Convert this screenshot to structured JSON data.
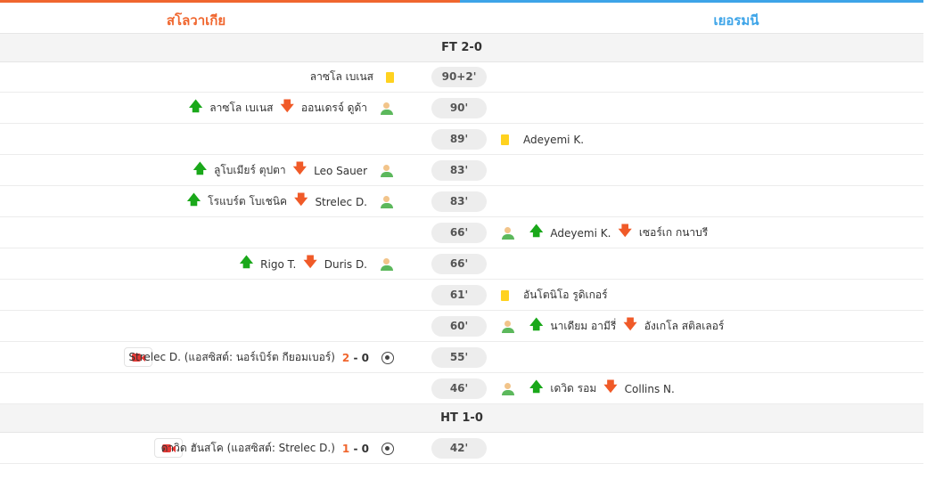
{
  "teams": {
    "home": "สโลวาเกีย",
    "away": "เยอรมนี"
  },
  "periods": {
    "ft": "FT 2-0",
    "ht": "HT 1-0"
  },
  "events": [
    {
      "minute": "90+2'",
      "side": "home",
      "type": "yellow",
      "player": "ลาซโล เบเนส"
    },
    {
      "minute": "90'",
      "side": "home",
      "type": "sub",
      "in": "ลาซโล เบเนส",
      "out": "ออนเดรจ์ ดูด้า"
    },
    {
      "minute": "89'",
      "side": "away",
      "type": "yellow",
      "player": "Adeyemi K."
    },
    {
      "minute": "83'",
      "side": "home",
      "type": "sub",
      "in": "ลูโบเมียร์ ตุปตา",
      "out": "Leo Sauer"
    },
    {
      "minute": "83'",
      "side": "home",
      "type": "sub",
      "in": "โรแบร์ต โบเชนิค",
      "out": "Strelec D."
    },
    {
      "minute": "66'",
      "side": "away",
      "type": "sub",
      "in": "Adeyemi K.",
      "out": "เซอร์เก กนาบรี"
    },
    {
      "minute": "66'",
      "side": "home",
      "type": "sub",
      "in": "Rigo T.",
      "out": "Duris D."
    },
    {
      "minute": "61'",
      "side": "away",
      "type": "yellow",
      "player": "อันโตนิโอ รูดิเกอร์"
    },
    {
      "minute": "60'",
      "side": "away",
      "type": "sub",
      "in": "นาเดียม อามีรี่",
      "out": "อังเกโล สติลเลอร์"
    },
    {
      "minute": "55'",
      "side": "home",
      "type": "goal",
      "text": "Strelec D. (แอสซิสต์: นอร์เบิร์ต กียอมเบอร์)",
      "score_home": "2",
      "sep": "-",
      "score_away": "0"
    },
    {
      "minute": "46'",
      "side": "away",
      "type": "sub",
      "in": "เดวิด รอม",
      "out": "Collins N."
    },
    {
      "minute": "42'",
      "side": "home",
      "type": "goal",
      "text": "ดาวิด ฮันสโค (แอสซิสต์: Strelec D.)",
      "score_home": "1",
      "sep": "-",
      "score_away": "0"
    }
  ]
}
